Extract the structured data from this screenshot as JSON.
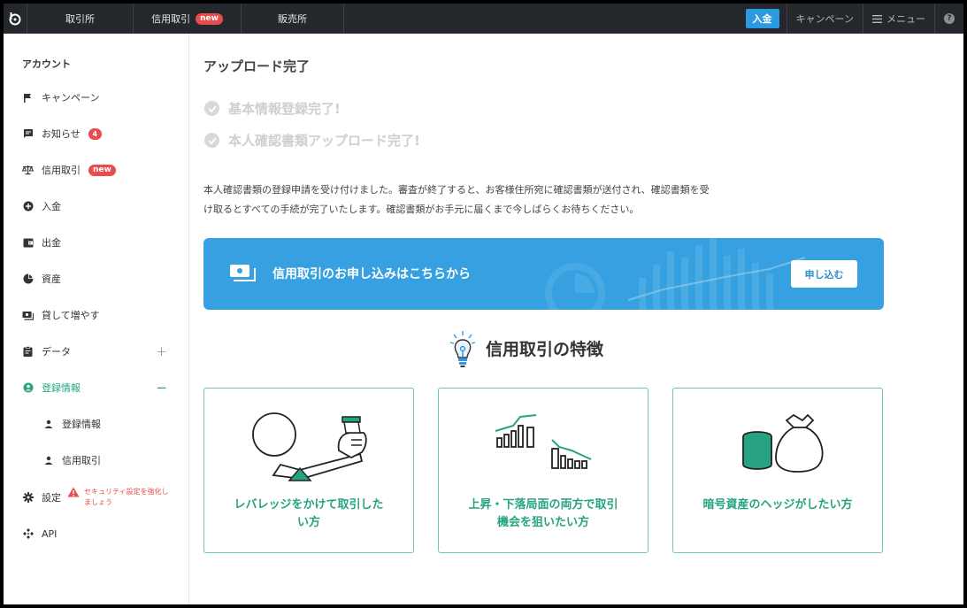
{
  "topbar": {
    "nav": [
      {
        "label": "取引所"
      },
      {
        "label": "信用取引",
        "badge": "new"
      },
      {
        "label": "販売所"
      }
    ],
    "deposit_label": "入金",
    "campaign_label": "キャンペーン",
    "menu_label": "メニュー",
    "help_glyph": "?"
  },
  "sidebar": {
    "title": "アカウント",
    "items": [
      {
        "label": "キャンペーン",
        "icon": "flag-icon"
      },
      {
        "label": "お知らせ",
        "icon": "message-icon",
        "badge": "4"
      },
      {
        "label": "信用取引",
        "icon": "scale-icon",
        "badge": "new"
      },
      {
        "label": "入金",
        "icon": "plus-circle-icon"
      },
      {
        "label": "出金",
        "icon": "wallet-icon"
      },
      {
        "label": "資産",
        "icon": "pie-chart-icon"
      },
      {
        "label": "貸して増やす",
        "icon": "lend-icon"
      },
      {
        "label": "データ",
        "icon": "clipboard-icon",
        "toggle": "+"
      },
      {
        "label": "登録情報",
        "icon": "account-circle-icon",
        "toggle": "−",
        "active": true
      },
      {
        "label": "登録情報",
        "icon": "person-icon",
        "sub": true
      },
      {
        "label": "信用取引",
        "icon": "person-icon",
        "sub": true
      },
      {
        "label": "設定",
        "icon": "gear-icon"
      },
      {
        "label": "API",
        "icon": "api-icon"
      }
    ],
    "security_warning": "セキュリティ設定を強化しましょう"
  },
  "main": {
    "title": "アップロード完了",
    "done_items": [
      "基本情報登録完了!",
      "本人確認書類アップロード完了!"
    ],
    "description_line1": "本人確認書類の登録申請を受け付けました。審査が終了すると、お客様住所宛に確認書類が送付され、確認書類を受",
    "description_line2": "け取るとすべての手続が完了いたします。確認書類がお手元に届くまで今しばらくお待ちください。",
    "banner": {
      "text": "信用取引のお申し込みはこちらから",
      "button": "申し込む"
    },
    "section_title": "信用取引の特徴",
    "cards": [
      {
        "line1": "レバレッジをかけて取引した",
        "line2": "い方"
      },
      {
        "line1": "上昇・下落局面の両方で取引",
        "line2": "機会を狙いたい方"
      },
      {
        "line1": "暗号資産のヘッジがしたい方",
        "line2": ""
      }
    ]
  },
  "colors": {
    "accent_green": "#27a382",
    "banner_blue": "#37a0e0",
    "badge_red": "#e84c4c",
    "topbar_bg": "#24272c"
  }
}
